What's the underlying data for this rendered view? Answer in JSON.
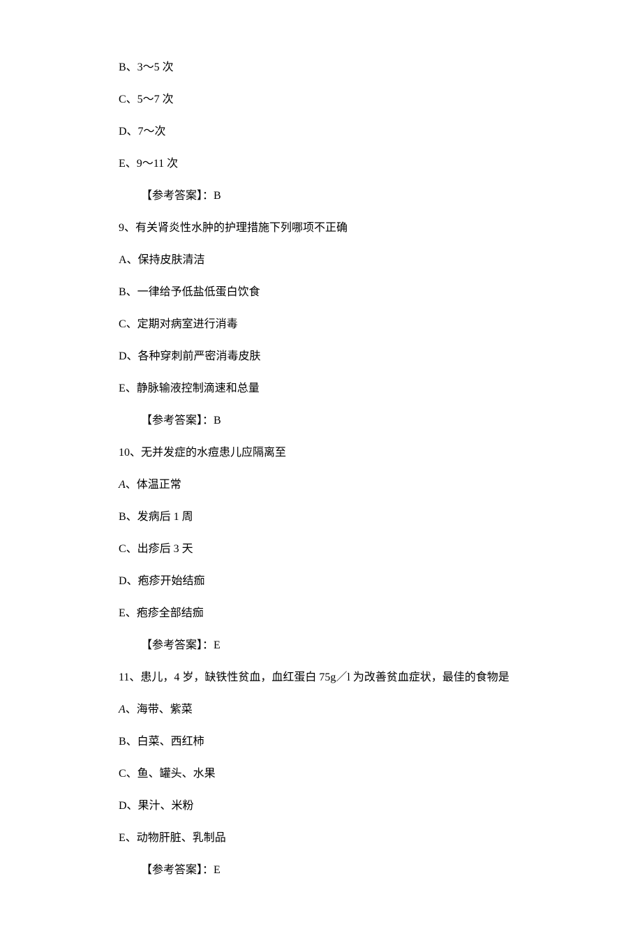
{
  "q8": {
    "optB": "B、3～5 次",
    "optC": "C、5～7 次",
    "optD": "D、7～次",
    "optE": "E、9～11 次",
    "answer": "【参考答案】：B"
  },
  "q9": {
    "stem": "9、有关肾炎性水肿的护理措施下列哪项不正确",
    "optA": "A、保持皮肤清洁",
    "optB": "B、一律给予低盐低蛋白饮食",
    "optC": "C、定期对病室进行消毒",
    "optD": "D、各种穿刺前严密消毒皮肤",
    "optE": "E、静脉输液控制滴速和总量",
    "answer": "【参考答案】：B"
  },
  "q10": {
    "stem": "10、无并发症的水痘患儿应隔离至",
    "optA_letter": "A",
    "optA_text": "、体温正常",
    "optB": "B、发病后 1 周",
    "optC": "C、出疹后 3 天",
    "optD": "D、疱疹开始结痂",
    "optE": "E、疱疹全部结痂",
    "answer": "【参考答案】：E"
  },
  "q11": {
    "stem": "11、患儿，4 岁，缺铁性贫血，血红蛋白 75g／l 为改善贫血症状，最佳的食物是",
    "optA_letter": "A",
    "optA_text": "、海带、紫菜",
    "optB": "B、白菜、西红柿",
    "optC": "C、鱼、罐头、水果",
    "optD": "D、果汁、米粉",
    "optE": "E、动物肝脏、乳制品",
    "answer": "【参考答案】：E"
  }
}
